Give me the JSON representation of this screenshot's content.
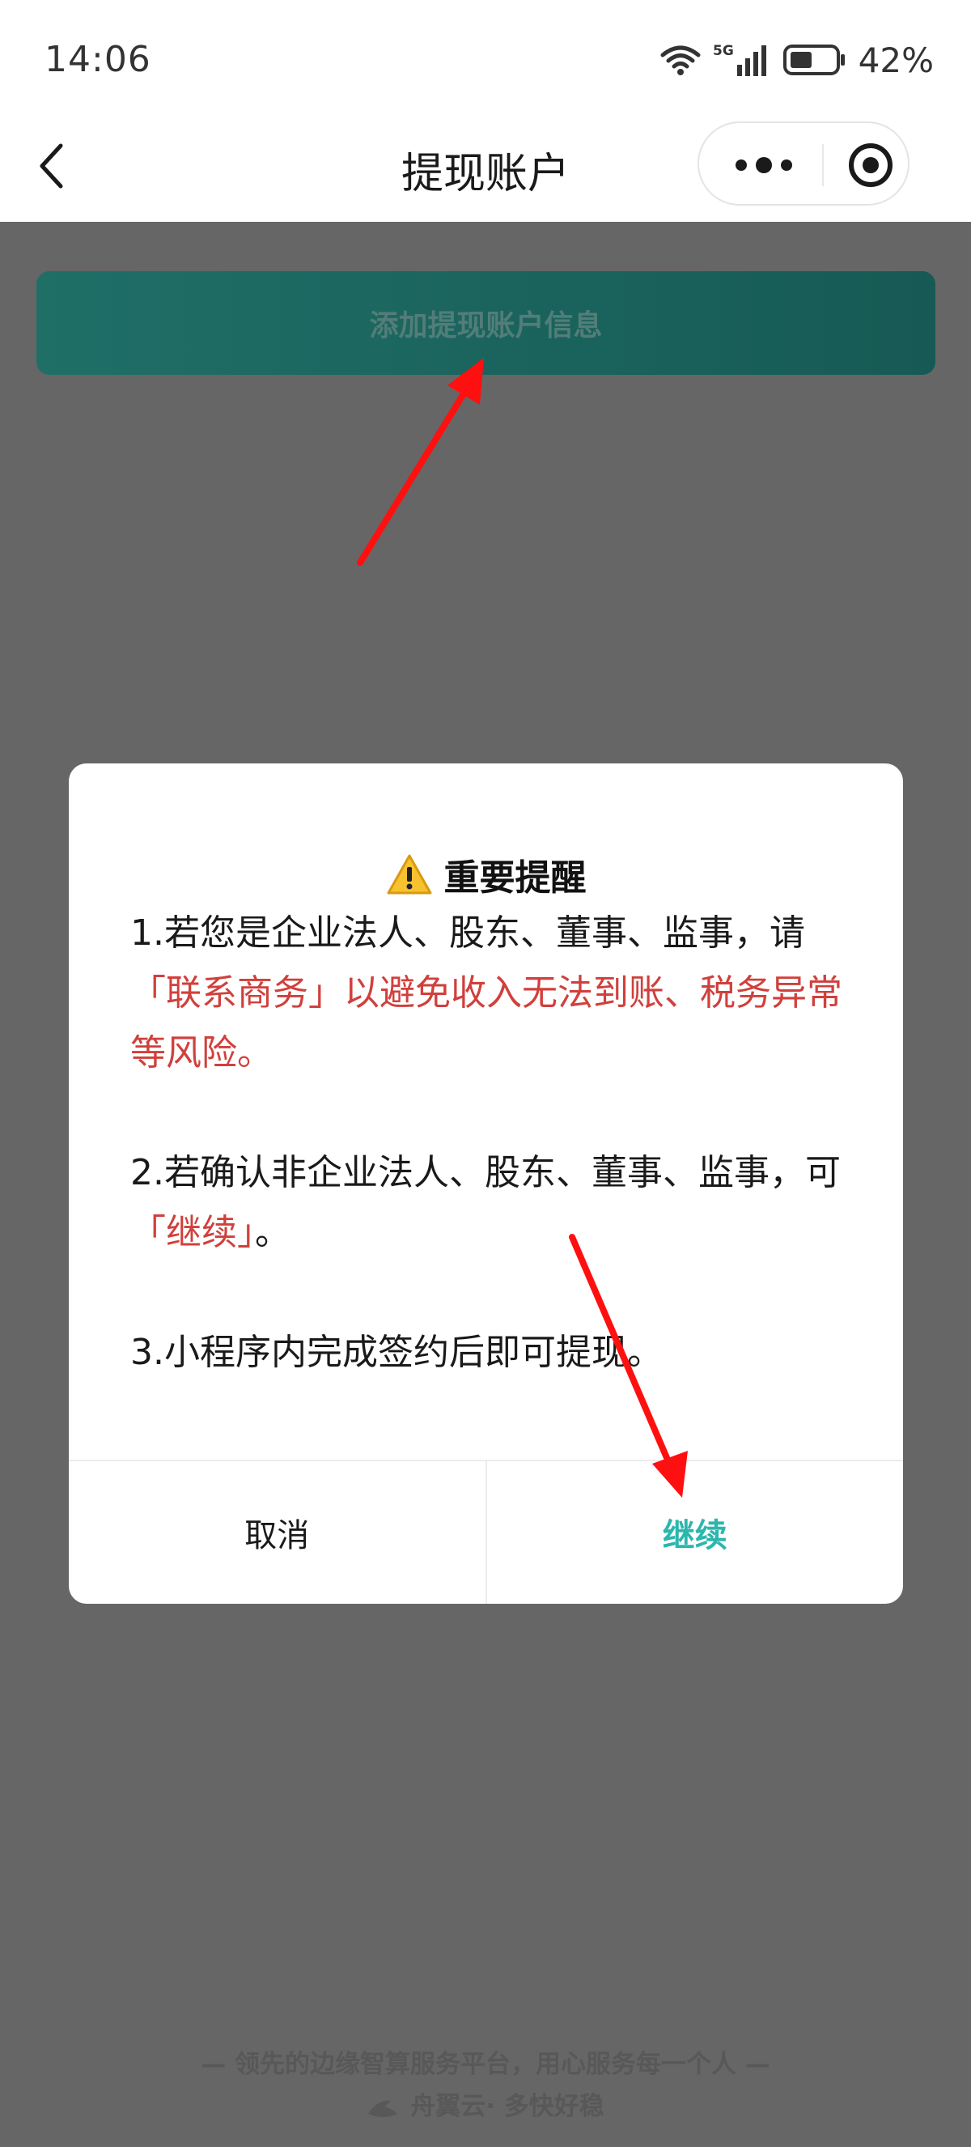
{
  "status_bar": {
    "time": "14:06",
    "network": "5G",
    "battery": "42%"
  },
  "nav": {
    "title": "提现账户",
    "icons": [
      "back-icon",
      "more-icon",
      "mini-program-close-icon"
    ]
  },
  "page": {
    "add_button_label": "添加提现账户信息",
    "footer_slogan": "— 领先的边缘智算服务平台，用心服务每一个人 —",
    "footer_brand": "舟翼云· 多快好稳"
  },
  "dialog": {
    "title": "重要提醒",
    "title_icon": "warning-icon",
    "item1_a": "1.若您是企业法人、股东、董事、监事，请",
    "item1_b": "「联系商务」以避免收入无法到账、税务异常等风险。",
    "item2_a": "2.若确认非企业法人、股东、董事、监事，可",
    "item2_b": "「继续」",
    "item2_c": "。",
    "item3": "3.小程序内完成签约后即可提现。",
    "cancel_label": "取消",
    "continue_label": "继续"
  },
  "colors": {
    "overlay": "#666666",
    "highlight_red": "#d0403c",
    "accent_teal": "#2cb6ad",
    "annotation_arrow": "#ff0000"
  }
}
